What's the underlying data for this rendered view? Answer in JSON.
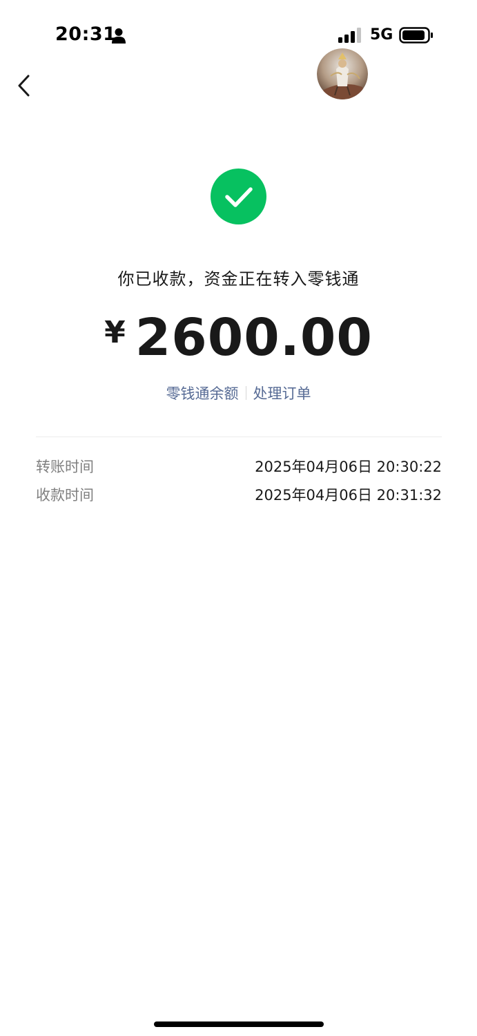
{
  "status_bar": {
    "time": "20:31",
    "network": "5G",
    "icons": [
      "person-icon",
      "signal-icon",
      "battery-icon"
    ]
  },
  "nav": {
    "back_icon": "chevron-left-icon",
    "avatar": "user-avatar"
  },
  "result": {
    "icon": "check-circle-icon",
    "icon_color": "#07c160",
    "message": "你已收款，资金正在转入零钱通",
    "currency_symbol": "¥",
    "amount": "2600.00"
  },
  "links": {
    "balance_label": "零钱通余额",
    "order_label": "处理订单",
    "link_color": "#576b95"
  },
  "details": [
    {
      "label": "转账时间",
      "value": "2025年04月06日 20:30:22"
    },
    {
      "label": "收款时间",
      "value": "2025年04月06日 20:31:32"
    }
  ]
}
